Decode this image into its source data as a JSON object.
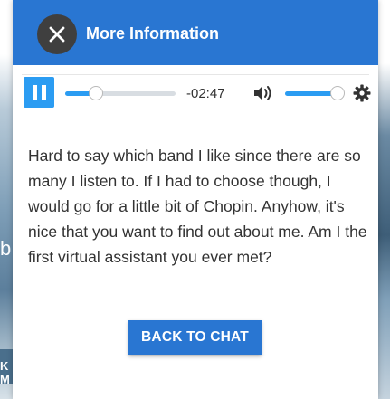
{
  "background": {
    "left_letter": "b",
    "left_band_text": "K M"
  },
  "dialog": {
    "title": "More Information",
    "close_icon": "close-icon"
  },
  "player": {
    "state": "playing",
    "play_pause_icon": "pause-icon",
    "progress_fraction": 0.28,
    "time_remaining": "-02:47",
    "volume_icon": "volume-icon",
    "volume_fraction": 1.0,
    "settings_icon": "gear-icon"
  },
  "message": {
    "text": "Hard to say which band I like since there are so many I listen to. If I had to choose though, I would go for a little bit of Chopin. Anyhow, it's nice that you want to find out about me. Am I the first virtual assistant you ever met?"
  },
  "actions": {
    "back_label": "BACK TO CHAT"
  },
  "colors": {
    "header": "#2976d2",
    "accent": "#2b9cf2",
    "close_button": "#3f3f3f",
    "text": "#333333"
  }
}
